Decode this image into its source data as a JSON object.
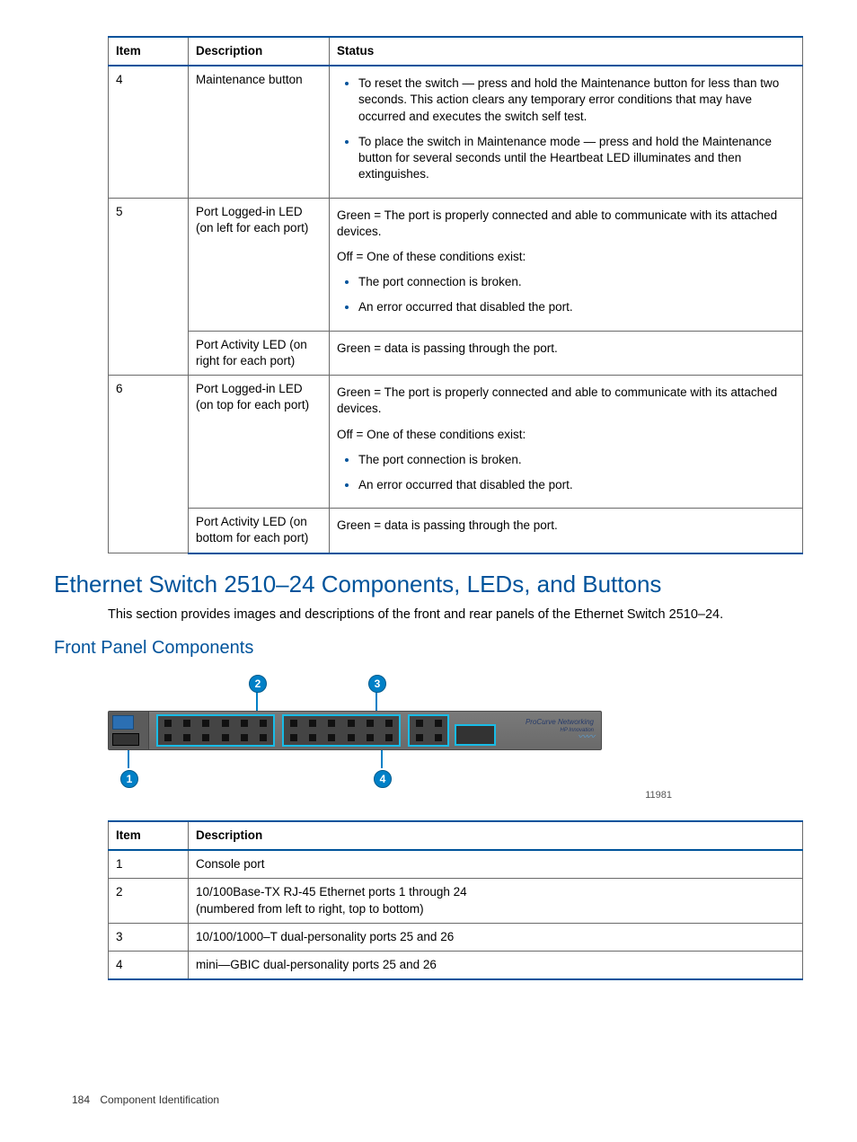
{
  "table1": {
    "headers": [
      "Item",
      "Description",
      "Status"
    ],
    "rows": [
      {
        "item": "4",
        "desc": "Maintenance button",
        "status_bullets": [
          "To reset the switch — press and hold the Maintenance button for less than two seconds. This action clears any temporary error conditions that may have occurred and executes the switch self test.",
          "To place the switch in Maintenance mode — press and hold the Maintenance button for several seconds until the Heartbeat LED illuminates and then extinguishes."
        ]
      },
      {
        "item": "5",
        "desc": "Port Logged-in LED (on left for each port)",
        "status_paras": [
          "Green = The port is properly connected and able to communicate with its attached devices.",
          "Off = One of these conditions exist:"
        ],
        "status_bullets": [
          "The port connection is broken.",
          "An error occurred that disabled the port."
        ]
      },
      {
        "item": "",
        "desc": "Port Activity LED (on right for each port)",
        "status_paras": [
          "Green = data is passing through the port."
        ]
      },
      {
        "item": "6",
        "desc": "Port Logged-in LED (on top for each port)",
        "status_paras": [
          "Green = The port is properly connected and able to communicate with its attached devices.",
          "Off = One of these conditions exist:"
        ],
        "status_bullets": [
          "The port connection is broken.",
          "An error occurred that disabled the port."
        ]
      },
      {
        "item": "",
        "desc": "Port Activity LED (on bottom for each port)",
        "status_paras": [
          "Green = data is passing through the port."
        ]
      }
    ]
  },
  "heading": "Ethernet Switch 2510–24 Components, LEDs, and Buttons",
  "intro": "This section provides images and descriptions of the front and rear panels of the Ethernet Switch 2510–24.",
  "subheading": "Front Panel Components",
  "diagram": {
    "callouts": {
      "c1": "1",
      "c2": "2",
      "c3": "3",
      "c4": "4"
    },
    "brand_top": "ProCurve Networking",
    "brand_sub": "HP Innovation",
    "image_id": "11981"
  },
  "table2": {
    "headers": [
      "Item",
      "Description"
    ],
    "rows": [
      {
        "item": "1",
        "desc": "Console port"
      },
      {
        "item": "2",
        "desc": "10/100Base-TX RJ-45 Ethernet ports 1 through 24\n(numbered from left to right, top to bottom)"
      },
      {
        "item": "3",
        "desc": "10/100/1000–T dual-personality ports 25 and 26"
      },
      {
        "item": "4",
        "desc": "mini—GBIC dual-personality ports 25 and 26"
      }
    ]
  },
  "footer": {
    "page_no": "184",
    "section": "Component Identification"
  }
}
